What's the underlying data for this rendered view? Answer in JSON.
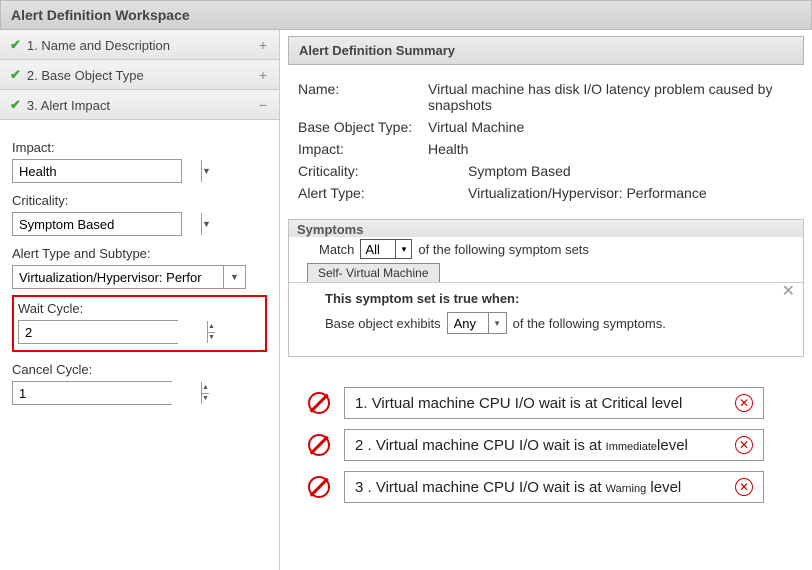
{
  "workspace": {
    "title": "Alert Definition Workspace"
  },
  "steps": [
    {
      "label": "1. Name and Description",
      "expand": "+"
    },
    {
      "label": "2. Base Object Type",
      "expand": "+"
    },
    {
      "label": "3. Alert Impact",
      "expand": "−"
    }
  ],
  "form": {
    "impact_label": "Impact:",
    "impact_value": "Health",
    "criticality_label": "Criticality:",
    "criticality_value": "Symptom Based",
    "alert_type_label": "Alert Type and Subtype:",
    "alert_type_value": "Virtualization/Hypervisor: Perfor",
    "wait_cycle_label": "Wait Cycle:",
    "wait_cycle_value": "2",
    "cancel_cycle_label": "Cancel Cycle:",
    "cancel_cycle_value": "1"
  },
  "summary": {
    "header": "Alert Definition Summary",
    "name_k": "Name:",
    "name_v": "Virtual machine has disk I/O latency problem caused by snapshots",
    "bot_k": "Base Object Type:",
    "bot_v": "Virtual Machine",
    "impact_k": "Impact:",
    "impact_v": "Health",
    "crit_k": "Criticality:",
    "crit_v": "Symptom Based",
    "atype_k": "Alert Type:",
    "atype_v": "Virtualization/Hypervisor: Performance"
  },
  "symptoms": {
    "header": "Symptoms",
    "match_label": "Match",
    "match_value": "All",
    "match_suffix": "of the following symptom sets",
    "tab": "Self- Virtual Machine",
    "set_title": "This symptom set is true when:",
    "base_line_pre": "Base object exhibits",
    "any_value": "Any",
    "base_line_post": "of the following symptoms."
  },
  "symptom_list": [
    {
      "num": "1.",
      "pre": "Virtual machine CPU I/O wait is at ",
      "level": "Critical",
      "post": " level"
    },
    {
      "num": "2 .",
      "pre": "Virtual machine CPU I/O wait is at",
      "level": "Immediate",
      "post": "level",
      "small_level": true
    },
    {
      "num": "3 .",
      "pre": "Virtual machine CPU I/O wait is at ",
      "level": "Warning",
      "post": " level",
      "small_level": true
    }
  ]
}
